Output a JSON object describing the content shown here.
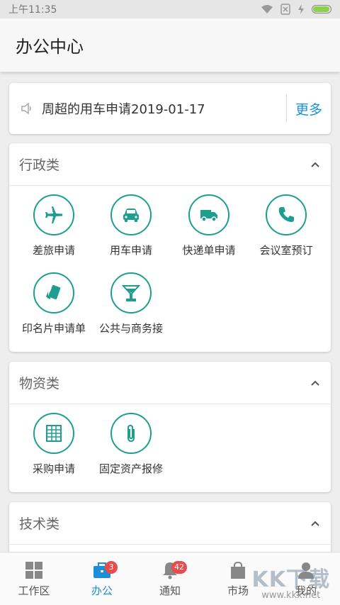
{
  "status": {
    "time": "上午11:35",
    "battery_level": 0.9
  },
  "header": {
    "title": "办公中心"
  },
  "notice": {
    "text": "周超的用车申请2019-01-17",
    "more": "更多"
  },
  "sections": [
    {
      "title": "行政类",
      "items": [
        {
          "label": "差旅申请",
          "icon": "airplane-icon"
        },
        {
          "label": "用车申请",
          "icon": "car-icon"
        },
        {
          "label": "快递单申请",
          "icon": "truck-icon"
        },
        {
          "label": "会议室预订",
          "icon": "phone-icon"
        },
        {
          "label": "印名片申请单",
          "icon": "cards-icon"
        },
        {
          "label": "公共与商务接",
          "icon": "cocktail-icon"
        }
      ]
    },
    {
      "title": "物资类",
      "items": [
        {
          "label": "采购申请",
          "icon": "spreadsheet-icon"
        },
        {
          "label": "固定资产报修",
          "icon": "paperclip-icon"
        }
      ]
    },
    {
      "title": "技术类",
      "items": []
    }
  ],
  "tabs": [
    {
      "label": "工作区",
      "icon": "grid-icon",
      "badge": ""
    },
    {
      "label": "办公",
      "icon": "briefcase-icon",
      "badge": "3"
    },
    {
      "label": "通知",
      "icon": "bell-icon",
      "badge": "42"
    },
    {
      "label": "市场",
      "icon": "bag-icon",
      "badge": ""
    },
    {
      "label": "我的",
      "icon": "person-icon",
      "badge": ""
    }
  ],
  "watermark": {
    "brand": "KK下载",
    "url": "www.kkx.net"
  },
  "colors": {
    "accent": "#1e9e8e",
    "link": "#1a8fd8",
    "badge": "#e94b4b"
  }
}
